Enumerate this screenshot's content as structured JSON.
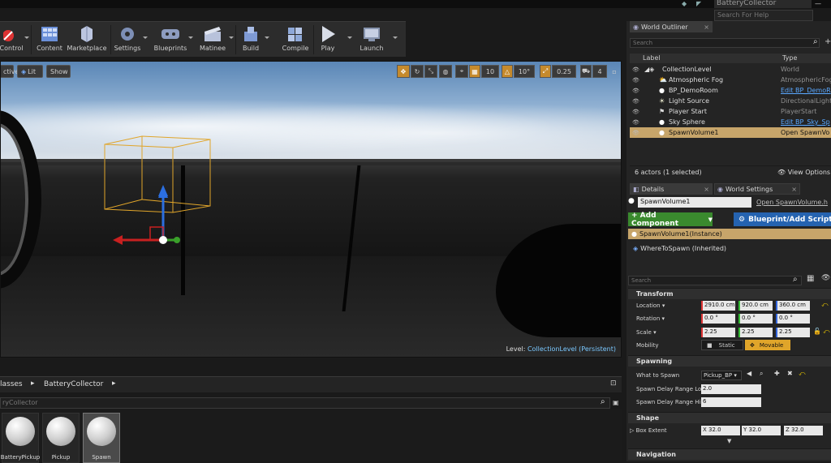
{
  "window": {
    "app_title": "BatteryCollector",
    "help_search_placeholder": "Search For Help"
  },
  "toolbar": {
    "buttons": [
      {
        "label": "Control",
        "icon": "control-icon"
      },
      {
        "label": "Content",
        "icon": "content-icon"
      },
      {
        "label": "Marketplace",
        "icon": "marketplace-icon"
      },
      {
        "label": "Settings",
        "icon": "settings-icon"
      },
      {
        "label": "Blueprints",
        "icon": "blueprints-icon"
      },
      {
        "label": "Matinee",
        "icon": "matinee-icon"
      },
      {
        "label": "Build",
        "icon": "build-icon"
      },
      {
        "label": "Compile",
        "icon": "compile-icon"
      },
      {
        "label": "Play",
        "icon": "play-icon"
      },
      {
        "label": "Launch",
        "icon": "launch-icon"
      }
    ]
  },
  "viewport": {
    "mode_label": "ctive",
    "lit_label": "Lit",
    "show_label": "Show",
    "grid_snap": "10",
    "rot_snap": "10°",
    "scale_snap": "0.25",
    "cam_speed": "4",
    "level_prefix": "Level:",
    "level_name": "CollectionLevel (Persistent)"
  },
  "content_browser": {
    "breadcrumb": [
      "lasses",
      "BatteryCollector"
    ],
    "search_text": "ryCollector",
    "assets": [
      {
        "label": "BatteryPickup"
      },
      {
        "label": "Pickup"
      },
      {
        "label": "Spawn"
      }
    ]
  },
  "outliner": {
    "tab": "World Outliner",
    "search_placeholder": "Search",
    "col_label": "Label",
    "col_type": "Type",
    "rows": [
      {
        "label": "CollectionLevel",
        "type": "World"
      },
      {
        "label": "Atmospheric Fog",
        "type": "AtmosphericFog"
      },
      {
        "label": "BP_DemoRoom",
        "type": "Edit BP_DemoR"
      },
      {
        "label": "Light Source",
        "type": "DirectionalLight"
      },
      {
        "label": "Player Start",
        "type": "PlayerStart"
      },
      {
        "label": "Sky Sphere",
        "type": "Edit BP_Sky_Sp"
      },
      {
        "label": "SpawnVolume1",
        "type": "Open SpawnVo"
      }
    ],
    "footer": "6 actors (1 selected)",
    "view_options": "View Options"
  },
  "details": {
    "tab": "Details",
    "tab2": "World Settings",
    "name": "SpawnVolume1",
    "open_link": "Open SpawnVolume.h",
    "add_component": "+ Add Component",
    "bp_script": "Blueprint/Add Script",
    "component_instance": "SpawnVolume1(Instance)",
    "component_inherited": "WhereToSpawn (Inherited)",
    "search_placeholder": "Search",
    "transform": {
      "title": "Transform",
      "location_label": "Location",
      "location": [
        "2910.0 cm",
        "920.0 cm",
        "360.0 cm"
      ],
      "rotation_label": "Rotation",
      "rotation": [
        "0.0 °",
        "0.0 °",
        "0.0 °"
      ],
      "scale_label": "Scale",
      "scale": [
        "2.25",
        "2.25",
        "2.25"
      ],
      "mobility_label": "Mobility",
      "mobility_static": "Static",
      "mobility_movable": "Movable"
    },
    "spawning": {
      "title": "Spawning",
      "what_label": "What to Spawn",
      "what_value": "Pickup_BP",
      "delay_low_label": "Spawn Delay Range Lo",
      "delay_low": "2.0",
      "delay_high_label": "Spawn Delay Range Hi",
      "delay_high": "6"
    },
    "shape": {
      "title": "Shape",
      "box_label": "Box Extent",
      "box": [
        "X 32.0",
        "Y 32.0",
        "Z 32.0"
      ]
    },
    "navigation": {
      "title": "Navigation"
    }
  }
}
